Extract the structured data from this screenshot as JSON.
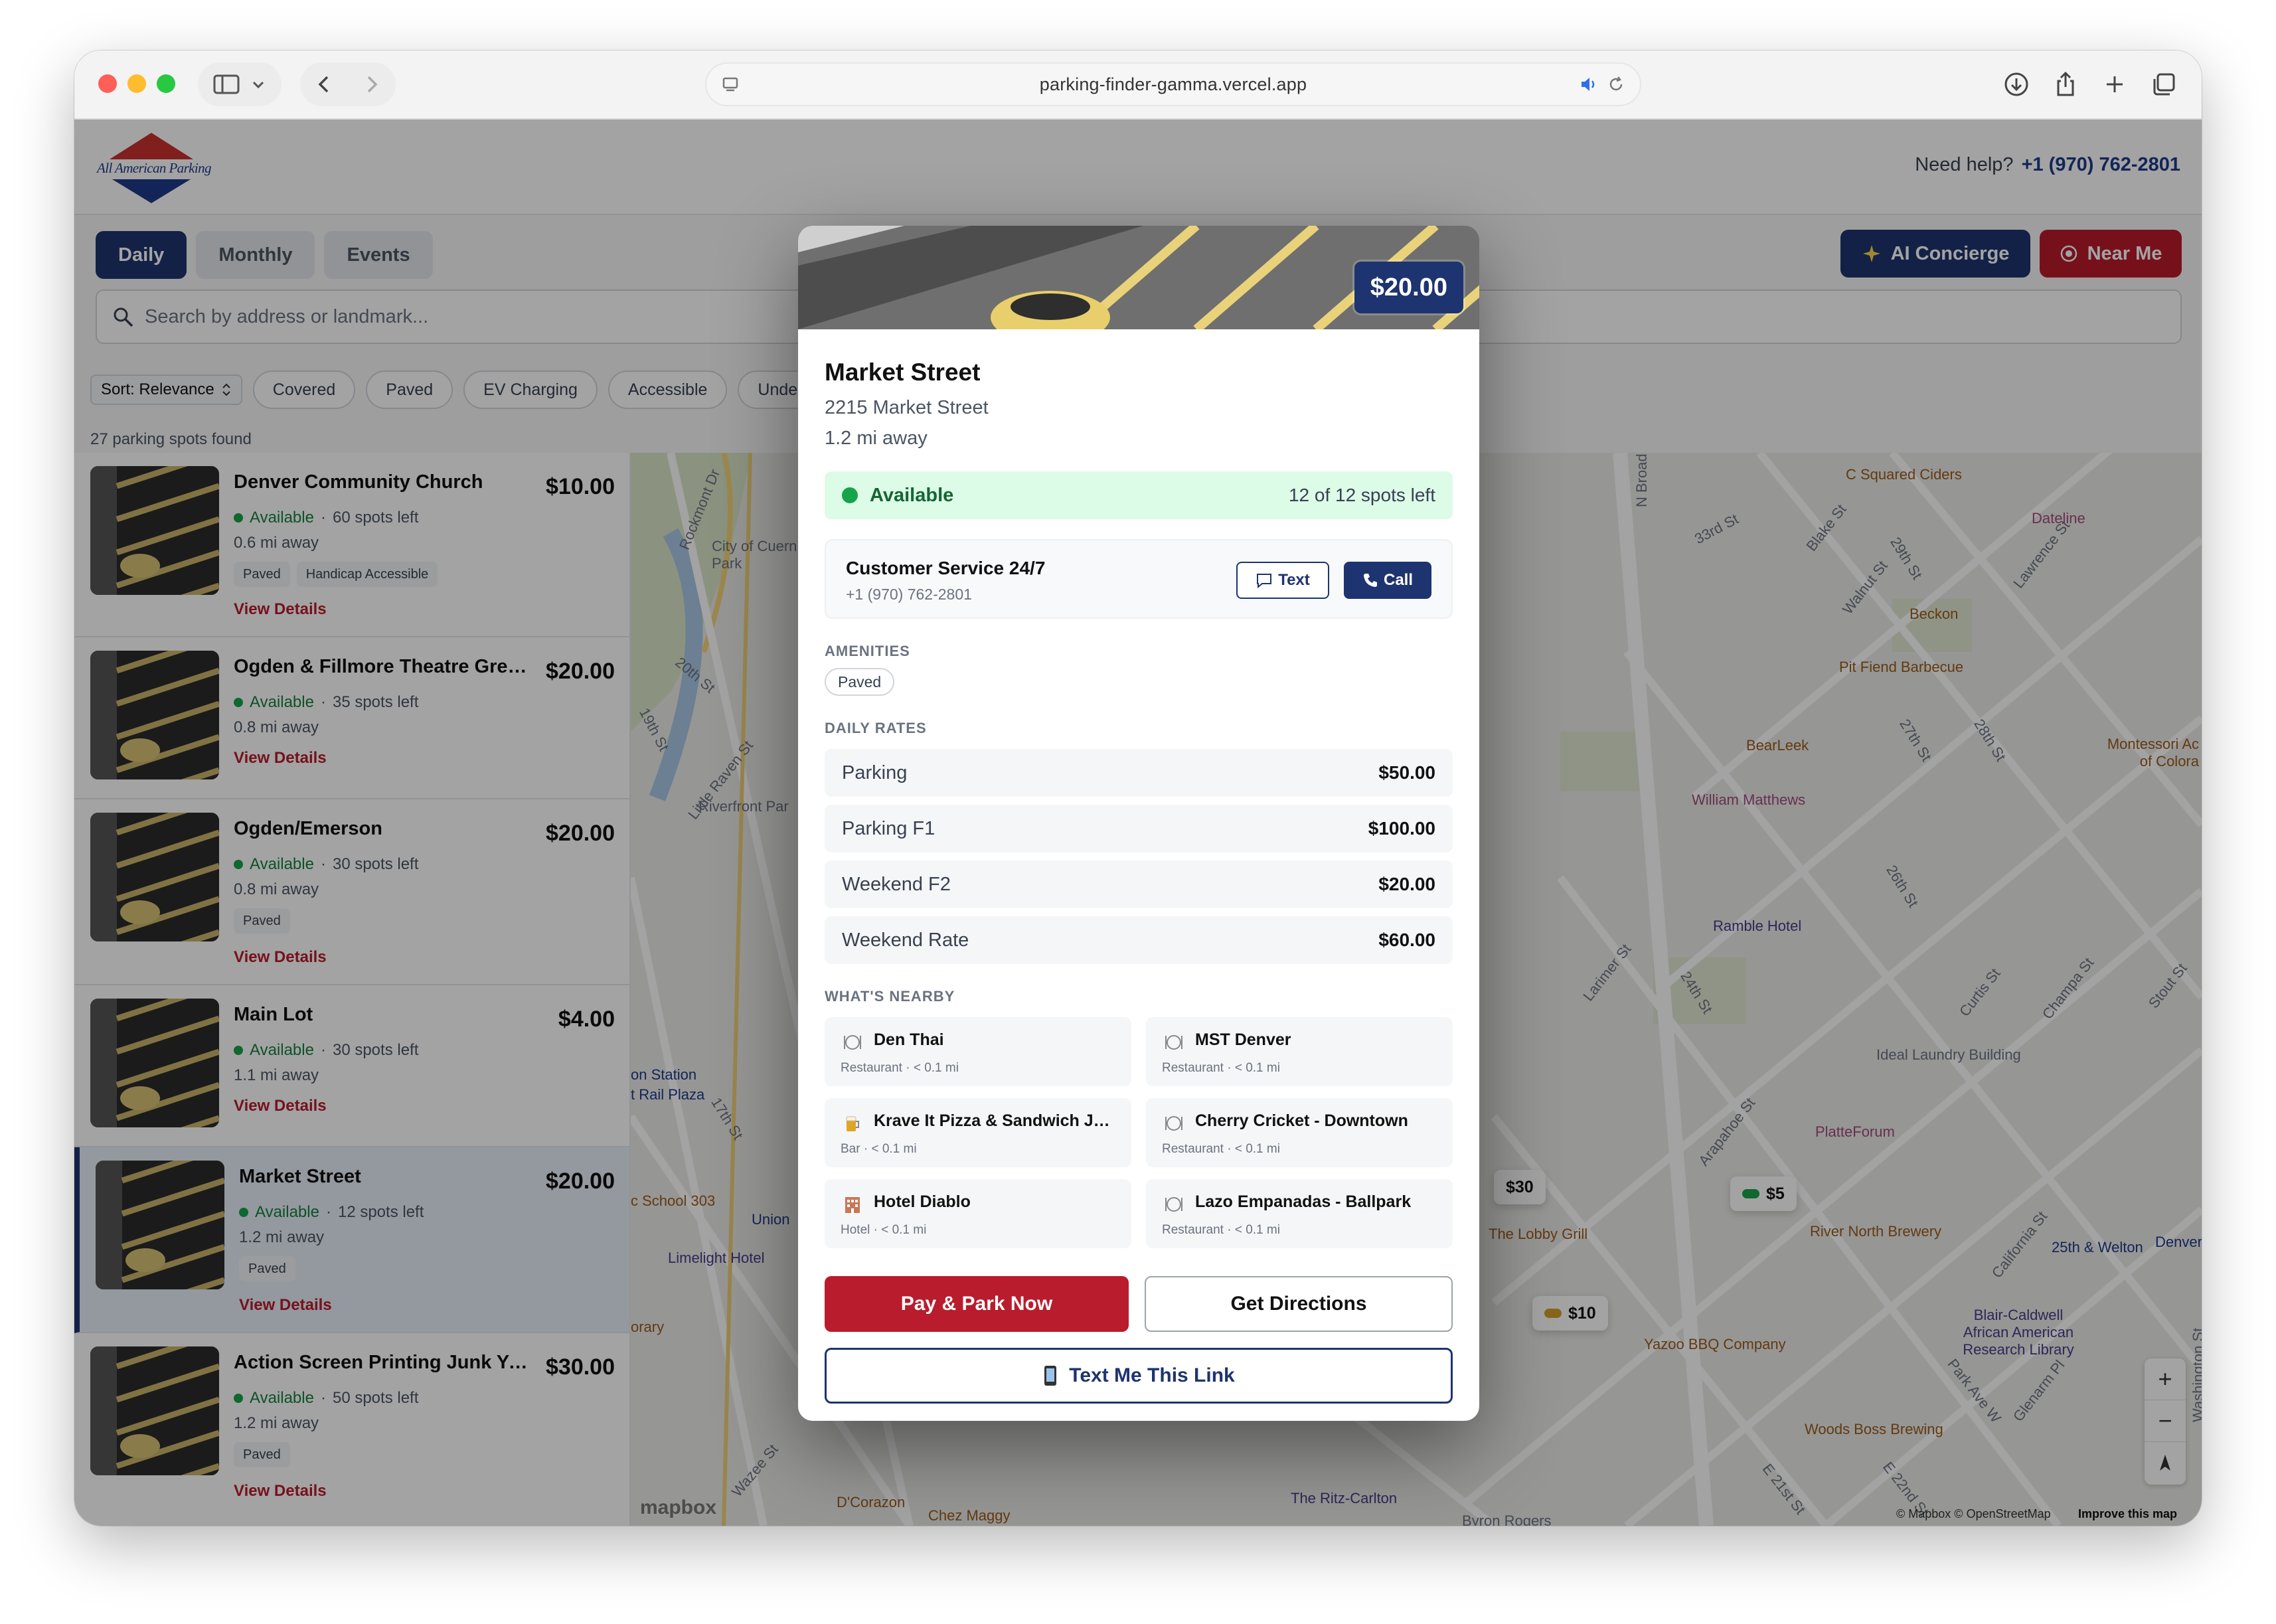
{
  "browser": {
    "url": "parking-finder-gamma.vercel.app"
  },
  "header": {
    "logo_text": "All American Parking",
    "help_label": "Need help?",
    "help_phone": "+1 (970) 762-2801"
  },
  "tabs": [
    {
      "label": "Daily",
      "active": true
    },
    {
      "label": "Monthly",
      "active": false
    },
    {
      "label": "Events",
      "active": false
    }
  ],
  "actions": {
    "concierge_label": "AI Concierge",
    "nearme_label": "Near Me"
  },
  "search": {
    "placeholder": "Search by address or landmark..."
  },
  "filters": {
    "sort_label": "Sort: Relevance",
    "chips": [
      "Covered",
      "Paved",
      "EV Charging",
      "Accessible",
      "Undergrou"
    ]
  },
  "results": {
    "count_text": "27 parking spots found",
    "items": [
      {
        "name": "Denver Community Church",
        "price": "$10.00",
        "available": "Available",
        "spots": "60 spots left",
        "distance": "0.6 mi away",
        "tags": [
          "Paved",
          "Handicap Accessible"
        ],
        "link": "View Details"
      },
      {
        "name": "Ogden & Fillmore Theatre Grea...",
        "price": "$20.00",
        "available": "Available",
        "spots": "35 spots left",
        "distance": "0.8 mi away",
        "tags": [],
        "link": "View Details"
      },
      {
        "name": "Ogden/Emerson",
        "price": "$20.00",
        "available": "Available",
        "spots": "30 spots left",
        "distance": "0.8 mi away",
        "tags": [
          "Paved"
        ],
        "link": "View Details"
      },
      {
        "name": "Main Lot",
        "price": "$4.00",
        "available": "Available",
        "spots": "30 spots left",
        "distance": "1.1 mi away",
        "tags": [],
        "link": "View Details"
      },
      {
        "name": "Market Street",
        "price": "$20.00",
        "available": "Available",
        "spots": "12 spots left",
        "distance": "1.2 mi away",
        "tags": [
          "Paved"
        ],
        "link": "View Details"
      },
      {
        "name": "Action Screen Printing Junk Yard",
        "price": "$30.00",
        "available": "Available",
        "spots": "50 spots left",
        "distance": "1.2 mi away",
        "tags": [
          "Paved"
        ],
        "link": "View Details"
      }
    ]
  },
  "map": {
    "labels": [
      "Rockmont Dr",
      "City of Cuern Park",
      "20th St",
      "19th St",
      "Little Raven St",
      "Riverfront Par",
      "on Station",
      "t Rail Plaza",
      "17th St",
      "c School 303",
      "Union",
      "Limelight Hotel",
      "orary",
      "Wazee St",
      "D'Corazon",
      "Chez Maggy",
      "The Ritz-Carlton",
      "Byron Rogers",
      "N Broad",
      "33rd St",
      "C Squared Ciders",
      "Blake St",
      "Walnut St",
      "29th St",
      "Lawrence St",
      "Dateline",
      "Beckon",
      "Pit Fiend Barbecue",
      "BearLeek",
      "William Matthews",
      "27th St",
      "28th St",
      "Montessori Ac of Colora",
      "Ramble Hotel",
      "Larimer St",
      "24th St",
      "26th St",
      "Curtis St",
      "Champa St",
      "Stout St",
      "Ideal Laundry Building",
      "Arapahoe St",
      "PlatteForum",
      "The Lobby Grill",
      "River North Brewery",
      "California St",
      "25th & Welton",
      "Denver",
      "Blair-Caldwell African American Research Library",
      "Yazoo BBQ Company",
      "Woods Boss Brewing",
      "Park Ave W",
      "Glenarm Pl",
      "E 21st St",
      "E 22nd St",
      "Washington St",
      "mapbox",
      "© Mapbox © OpenStreetMap",
      "Improve this map"
    ],
    "price_pills": [
      "$30",
      "$5",
      "$10"
    ],
    "zoom_in": "+",
    "zoom_out": "−"
  },
  "modal": {
    "price": "$20.00",
    "title": "Market Street",
    "address": "2215 Market Street",
    "distance": "1.2 mi away",
    "availability": "Available",
    "spots": "12 of 12 spots left",
    "cs_title": "Customer Service 24/7",
    "cs_phone": "+1 (970) 762-2801",
    "text_btn": "Text",
    "call_btn": "Call",
    "amenities_heading": "AMENITIES",
    "amenities": [
      "Paved"
    ],
    "rates_heading": "DAILY RATES",
    "rates": [
      {
        "label": "Parking",
        "value": "$50.00"
      },
      {
        "label": "Parking F1",
        "value": "$100.00"
      },
      {
        "label": "Weekend F2",
        "value": "$20.00"
      },
      {
        "label": "Weekend Rate",
        "value": "$60.00"
      }
    ],
    "nearby_heading": "WHAT'S NEARBY",
    "nearby": [
      {
        "name": "Den Thai",
        "meta": "Restaurant · < 0.1 mi",
        "icon": "restaurant-icon"
      },
      {
        "name": "MST Denver",
        "meta": "Restaurant · < 0.1 mi",
        "icon": "restaurant-icon"
      },
      {
        "name": "Krave It Pizza & Sandwich Joi...",
        "meta": "Bar · < 0.1 mi",
        "icon": "bar-icon"
      },
      {
        "name": "Cherry Cricket - Downtown",
        "meta": "Restaurant · < 0.1 mi",
        "icon": "restaurant-icon"
      },
      {
        "name": "Hotel Diablo",
        "meta": "Hotel · < 0.1 mi",
        "icon": "hotel-icon"
      },
      {
        "name": "Lazo Empanadas - Ballpark",
        "meta": "Restaurant · < 0.1 mi",
        "icon": "restaurant-icon"
      }
    ],
    "pay_btn": "Pay & Park Now",
    "directions_btn": "Get Directions",
    "textlink_btn": "Text Me This Link"
  },
  "colors": {
    "navy": "#1e3470",
    "red": "#b91c2c",
    "green": "#16a34a"
  }
}
